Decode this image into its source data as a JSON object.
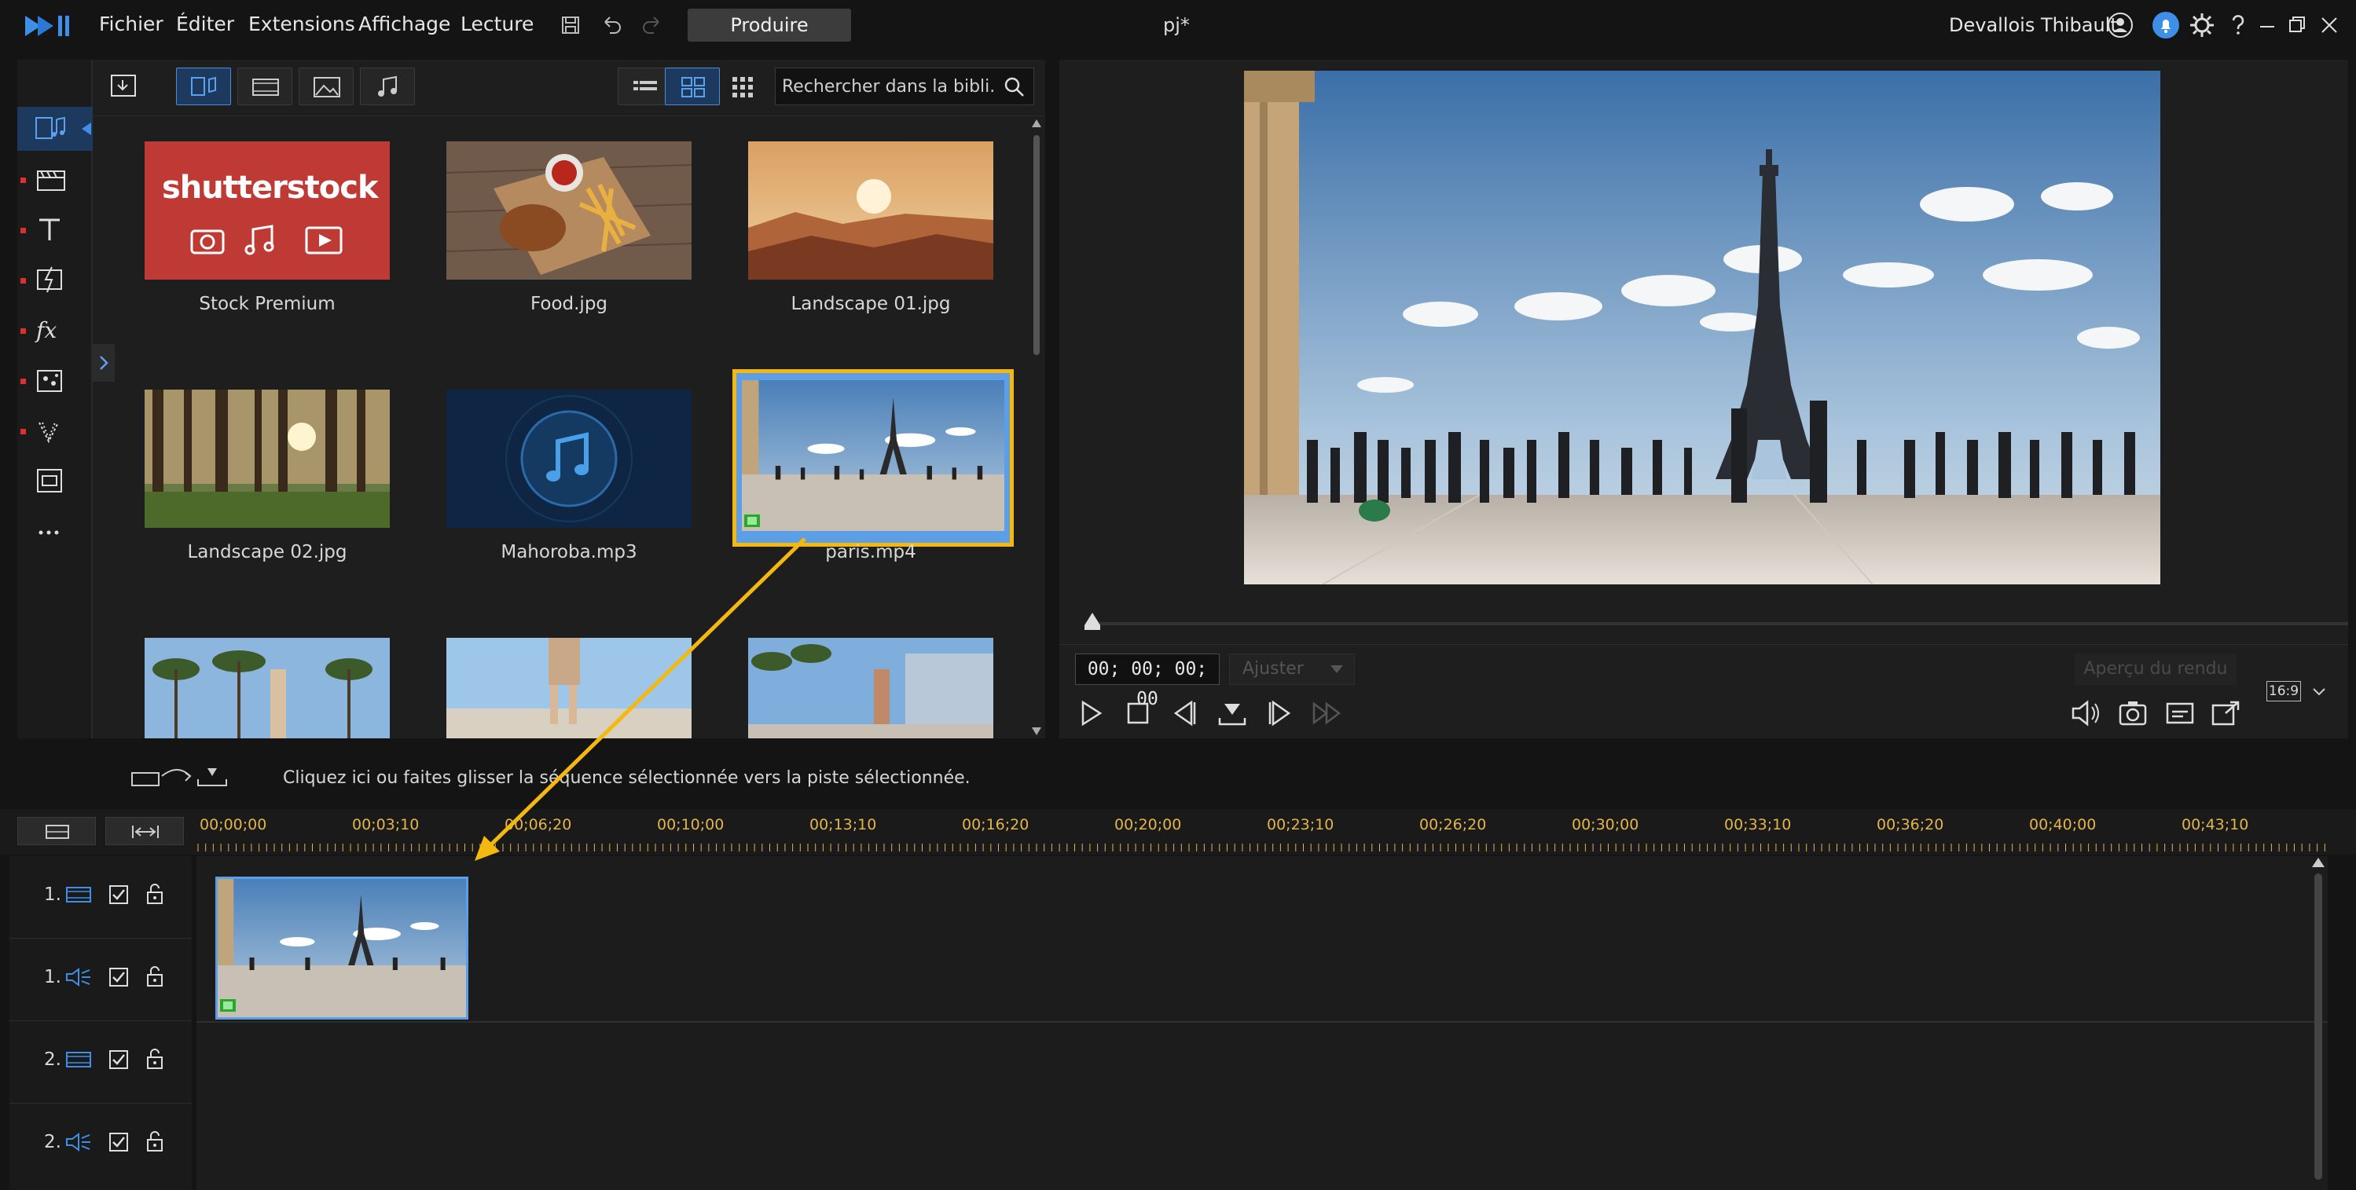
{
  "menu": {
    "items": [
      "Fichier",
      "Éditer",
      "Extensions",
      "Affichage",
      "Lecture"
    ],
    "produce_label": "Produire",
    "document_title": "pj*",
    "user_name": "Devallois Thibault"
  },
  "library": {
    "search_placeholder": "Rechercher dans la bibli...",
    "items": [
      {
        "label": "Stock Premium"
      },
      {
        "label": "Food.jpg"
      },
      {
        "label": "Landscape 01.jpg"
      },
      {
        "label": "Landscape 02.jpg"
      },
      {
        "label": "Mahoroba.mp3"
      },
      {
        "label": "paris.mp4"
      }
    ],
    "shutterstock_text": "shutterstock"
  },
  "preview": {
    "timecode": "00; 00; 00; 00",
    "fit_label": "Ajuster",
    "render_label": "Aperçu du rendu",
    "aspect_ratio": "16:9"
  },
  "timeline": {
    "hint": "Cliquez ici ou faites glisser la séquence sélectionnée vers la piste sélectionnée.",
    "ruler_labels": [
      "00;00;00",
      "00;03;10",
      "00;06;20",
      "00;10;00",
      "00;13;10",
      "00;16;20",
      "00;20;00",
      "00;23;10",
      "00;26;20",
      "00;30;00",
      "00;33;10",
      "00;36;20",
      "00;40;00",
      "00;43;10"
    ],
    "tracks": [
      {
        "num": "1.",
        "kind": "video"
      },
      {
        "num": "1.",
        "kind": "audio"
      },
      {
        "num": "2.",
        "kind": "video"
      },
      {
        "num": "2.",
        "kind": "audio"
      }
    ]
  },
  "colors": {
    "accent": "#4e8bd6",
    "highlight": "#f5b80f",
    "ruler_text": "#e3b54b"
  }
}
